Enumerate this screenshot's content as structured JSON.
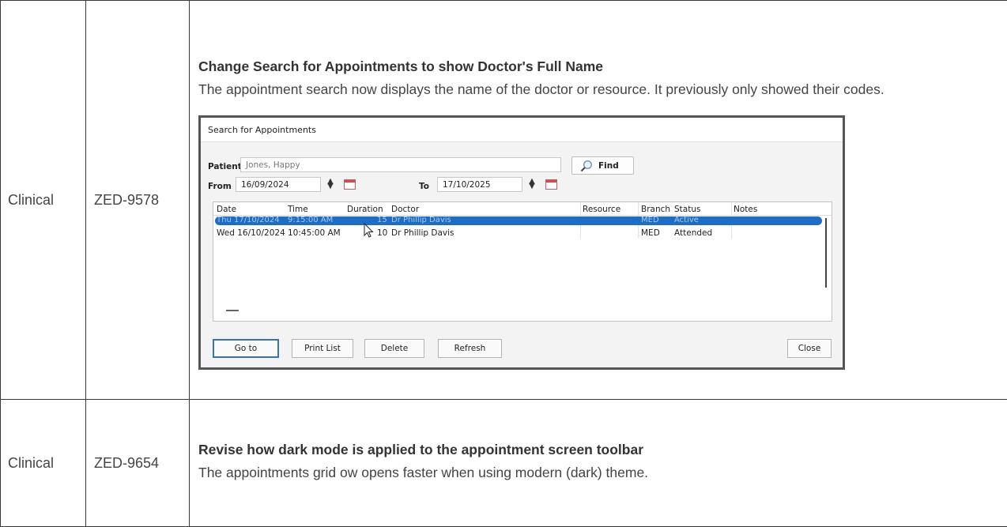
{
  "rows": [
    {
      "category": "Clinical",
      "code": "ZED-9578",
      "title": "Change Search for Appointments to show Doctor's Full Name",
      "body": "The appointment search now displays the name of the doctor or resource. It previously only showed their codes."
    },
    {
      "category": "Clinical",
      "code": "ZED-9654",
      "title": "Revise how dark mode is applied to the appointment screen toolbar",
      "body": "The appointments grid ow opens faster when using modern (dark) theme."
    }
  ],
  "dialog": {
    "title": "Search for Appointments",
    "patient_label": "Patient",
    "patient_value": "Jones, Happy",
    "find_label": "Find",
    "from_label": "From",
    "from_value": "16/09/2024",
    "to_label": "To",
    "to_value": "17/10/2025",
    "columns": [
      "Date",
      "Time",
      "Duration",
      "Doctor",
      "Resource",
      "Branch",
      "Status",
      "Notes"
    ],
    "results": [
      {
        "date": "Thu 17/10/2024",
        "time": "9:15:00 AM",
        "duration": "15",
        "doctor": "Dr Phillip Davis",
        "resource": "",
        "branch": "MED",
        "status": "Active",
        "notes": "",
        "selected": true
      },
      {
        "date": "Wed 16/10/2024",
        "time": "10:45:00 AM",
        "duration": "10",
        "doctor": "Dr Phillip Davis",
        "resource": "",
        "branch": "MED",
        "status": "Attended",
        "notes": "",
        "selected": false
      }
    ],
    "buttons": {
      "goto": "Go to",
      "print_list": "Print List",
      "delete": "Delete",
      "refresh": "Refresh",
      "close": "Close"
    }
  }
}
